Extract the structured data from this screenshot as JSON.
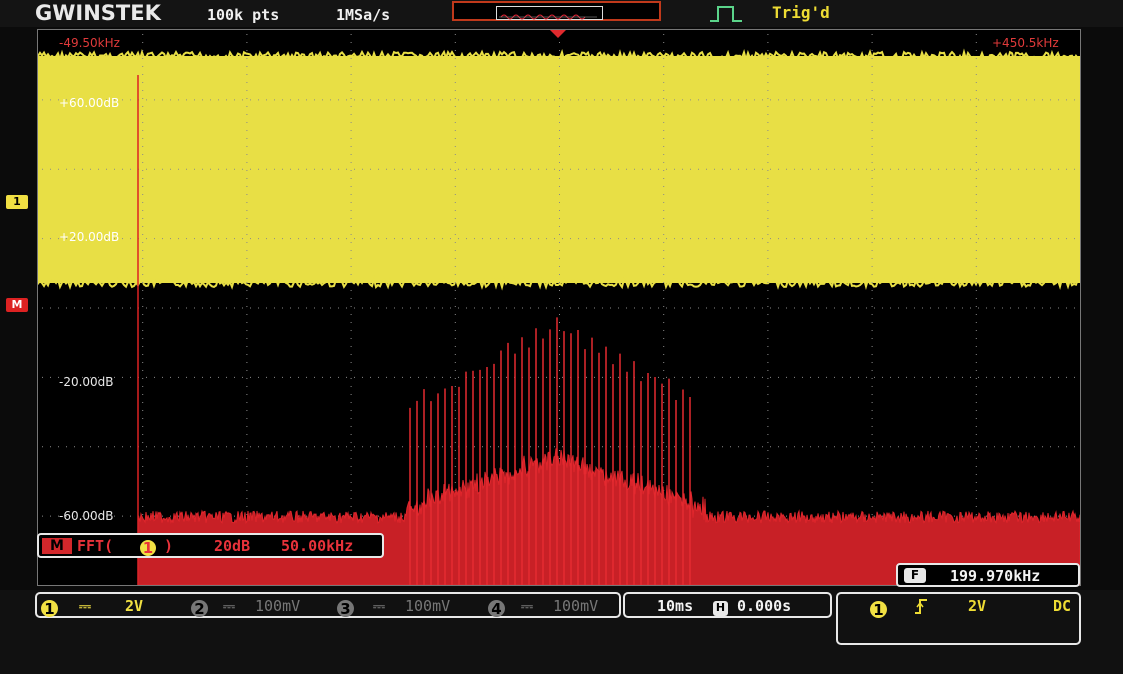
{
  "header": {
    "brand": "GWINSTEK",
    "record_length": "100k pts",
    "sample_rate": "1MSa/s",
    "trigger_status": "Trig'd"
  },
  "screen": {
    "start_freq": "-49.50kHz",
    "end_freq": "+450.5kHz",
    "yellow_labels": [
      "+60.00dB",
      "+20.00dB"
    ],
    "red_labels": [
      "-20.00dB",
      "-60.00dB"
    ],
    "ch1_marker": "1",
    "math_marker": "M"
  },
  "fft_info": {
    "math_label": "M",
    "function": "FFT(",
    "source": "1",
    "close": ")",
    "scale": "20dB",
    "span": "50.00kHz"
  },
  "frequency_counter": {
    "icon": "F",
    "value": "199.970kHz"
  },
  "channels": [
    {
      "num": "1",
      "coupling": "⎓",
      "scale": "2V",
      "color": "#f1e043"
    },
    {
      "num": "2",
      "coupling": "⎓",
      "scale": "100mV",
      "color": "#777777"
    },
    {
      "num": "3",
      "coupling": "⎓",
      "scale": "100mV",
      "color": "#777777"
    },
    {
      "num": "4",
      "coupling": "⎓",
      "scale": "100mV",
      "color": "#777777"
    }
  ],
  "timebase": {
    "scale": "10ms",
    "position_icon": "H",
    "position": "0.000s"
  },
  "trigger": {
    "source": "1",
    "slope_icon": "rising-edge-icon",
    "level": "2V",
    "coupling": "DC"
  },
  "colors": {
    "ch1": "#f1e043",
    "math": "#e02a2e",
    "trigger": "#eedc34",
    "border": "#c0391b"
  }
}
